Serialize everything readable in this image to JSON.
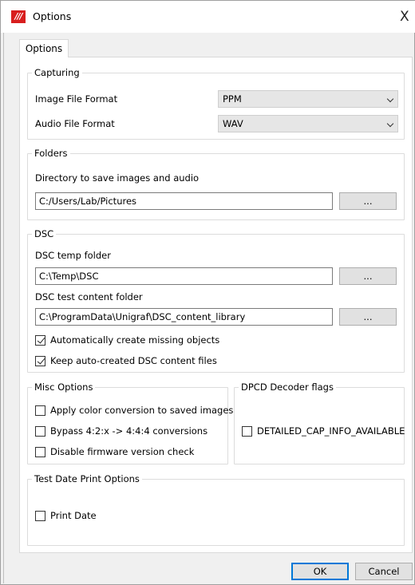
{
  "window": {
    "title": "Options",
    "close_glyph": "X"
  },
  "tabs": [
    {
      "label": "Options",
      "active": true
    }
  ],
  "capturing": {
    "title": "Capturing",
    "image_format_label": "Image File Format",
    "image_format_value": "PPM",
    "audio_format_label": "Audio File Format",
    "audio_format_value": "WAV"
  },
  "folders": {
    "title": "Folders",
    "dir_label": "Directory to save images and audio",
    "dir_value": "C:/Users/Lab/Pictures",
    "browse_label": "..."
  },
  "dsc": {
    "title": "DSC",
    "temp_label": "DSC temp folder",
    "temp_value": "C:\\Temp\\DSC",
    "temp_browse": "...",
    "content_label": "DSC test content folder",
    "content_value": "C:\\ProgramData\\Unigraf\\DSC_content_library",
    "content_browse": "...",
    "auto_create_label": "Automatically create missing objects",
    "auto_create_checked": true,
    "keep_files_label": "Keep auto-created DSC content files",
    "keep_files_checked": true
  },
  "misc": {
    "title": "Misc Options",
    "color_conv_label": "Apply color conversion to saved images",
    "color_conv_checked": false,
    "bypass_label": "Bypass 4:2:x -> 4:4:4 conversions",
    "bypass_checked": false,
    "disable_fw_label": "Disable firmware version check",
    "disable_fw_checked": false
  },
  "dpcd": {
    "title": "DPCD Decoder flags",
    "detailed_label": "DETAILED_CAP_INFO_AVAILABLE",
    "detailed_checked": false
  },
  "test_date": {
    "title": "Test Date Print Options",
    "print_date_label": "Print Date",
    "print_date_checked": false
  },
  "footer": {
    "ok_label": "OK",
    "cancel_label": "Cancel"
  },
  "colors": {
    "app_icon": "#d81e1e",
    "focus_border": "#0078d7"
  }
}
